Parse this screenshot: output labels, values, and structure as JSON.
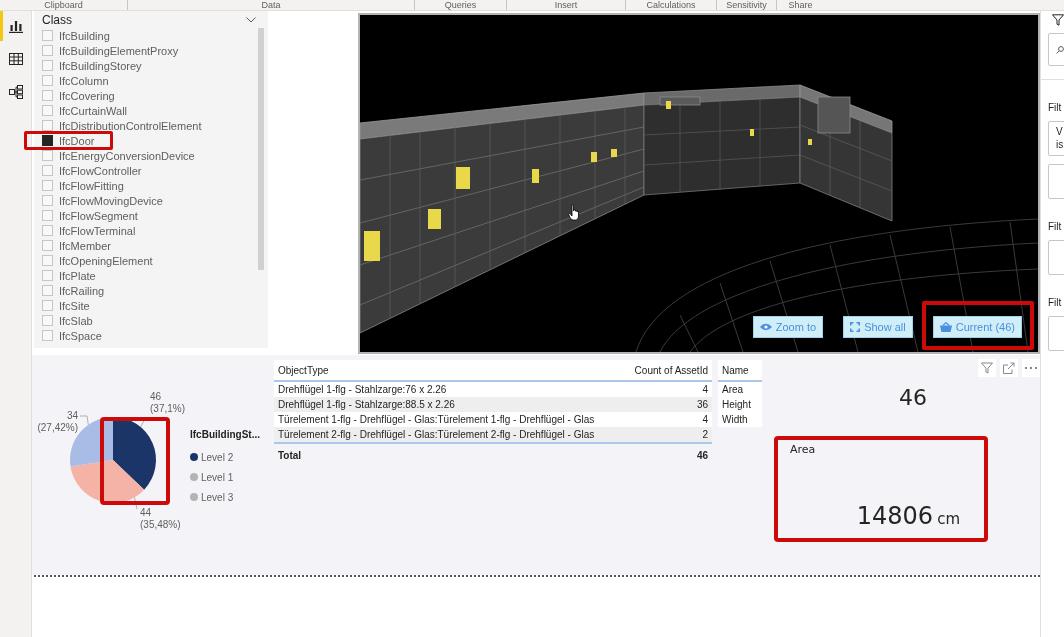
{
  "ribbon": {
    "groups": [
      "Clipboard",
      "Data",
      "Queries",
      "Insert",
      "Calculations",
      "Sensitivity",
      "Share"
    ]
  },
  "nav_rail": {
    "items": [
      {
        "kind": "report",
        "selected": true
      },
      {
        "kind": "data",
        "selected": false
      },
      {
        "kind": "model",
        "selected": false
      }
    ]
  },
  "class_slicer": {
    "title": "Class",
    "items": [
      {
        "label": "IfcBuilding",
        "checked": false,
        "highlighted": false
      },
      {
        "label": "IfcBuildingElementProxy",
        "checked": false,
        "highlighted": false
      },
      {
        "label": "IfcBuildingStorey",
        "checked": false,
        "highlighted": false
      },
      {
        "label": "IfcColumn",
        "checked": false,
        "highlighted": false
      },
      {
        "label": "IfcCovering",
        "checked": false,
        "highlighted": false
      },
      {
        "label": "IfcCurtainWall",
        "checked": false,
        "highlighted": false
      },
      {
        "label": "IfcDistributionControlElement",
        "checked": false,
        "highlighted": false
      },
      {
        "label": "IfcDoor",
        "checked": true,
        "highlighted": true
      },
      {
        "label": "IfcEnergyConversionDevice",
        "checked": false,
        "highlighted": false
      },
      {
        "label": "IfcFlowController",
        "checked": false,
        "highlighted": false
      },
      {
        "label": "IfcFlowFitting",
        "checked": false,
        "highlighted": false
      },
      {
        "label": "IfcFlowMovingDevice",
        "checked": false,
        "highlighted": false
      },
      {
        "label": "IfcFlowSegment",
        "checked": false,
        "highlighted": false
      },
      {
        "label": "IfcFlowTerminal",
        "checked": false,
        "highlighted": false
      },
      {
        "label": "IfcMember",
        "checked": false,
        "highlighted": false
      },
      {
        "label": "IfcOpeningElement",
        "checked": false,
        "highlighted": false
      },
      {
        "label": "IfcPlate",
        "checked": false,
        "highlighted": false
      },
      {
        "label": "IfcRailing",
        "checked": false,
        "highlighted": false
      },
      {
        "label": "IfcSite",
        "checked": false,
        "highlighted": false
      },
      {
        "label": "IfcSlab",
        "checked": false,
        "highlighted": false
      },
      {
        "label": "IfcSpace",
        "checked": false,
        "highlighted": false
      }
    ]
  },
  "model_viewer": {
    "buttons": [
      {
        "kind": "zoom",
        "label": "Zoom to",
        "highlighted": false
      },
      {
        "kind": "show_all",
        "label": "Show all",
        "highlighted": false
      },
      {
        "kind": "current",
        "label": "Current (46)",
        "highlighted": true
      }
    ]
  },
  "pie_visual": {
    "highlighted": true,
    "legend": {
      "title": "IfcBuildingSt...",
      "items": [
        {
          "color": "#1b3568"
        },
        {
          "color": "#b3b3b3"
        },
        {
          "color": "#b3b3b3"
        }
      ]
    },
    "chart_data": {
      "type": "pie",
      "categories": [
        "Level 2",
        "Level 1",
        "Level 3"
      ],
      "values": [
        46,
        44,
        34
      ],
      "colors": [
        "#1b3568",
        "#f4b3a6",
        "#a8bce6"
      ],
      "value_labels": [
        "46 (37,1%)",
        "44 (35,48%)",
        "34 (27,42%)"
      ]
    }
  },
  "object_table": {
    "columns": [
      "ObjectType",
      "Count of AssetId"
    ],
    "rows": [
      [
        "Drehflügel 1-flg - Stahlzarge:76 x 2.26",
        "4"
      ],
      [
        "Drehflügel 1-flg - Stahlzarge:88.5 x 2.26",
        "36"
      ],
      [
        "Türelement 1-flg - Drehflügel - Glas:Türelement 1-flg - Drehflügel - Glas",
        "4"
      ],
      [
        "Türelement 2-flg - Drehflügel - Glas:Türelement 2-flg - Drehflügel - Glas",
        "2"
      ]
    ],
    "total": [
      "Total",
      "46"
    ]
  },
  "name_table": {
    "columns": [
      "Name"
    ],
    "rows": [
      "Area",
      "Height",
      "Width"
    ]
  },
  "count_card": {
    "value": "46"
  },
  "area_card": {
    "label": "Area",
    "value": "14806",
    "unit": "cm",
    "highlighted": true
  },
  "filter_pane": {
    "sections": [
      {
        "label": "Filt",
        "cards": [
          {
            "kind": "text",
            "lines": [
              "V",
              "is"
            ]
          },
          {
            "kind": "blank"
          }
        ]
      },
      {
        "label": "Filt",
        "cards": [
          {
            "kind": "blank"
          }
        ]
      },
      {
        "label": "Filt",
        "cards": [
          {
            "kind": "blank"
          }
        ]
      }
    ]
  }
}
